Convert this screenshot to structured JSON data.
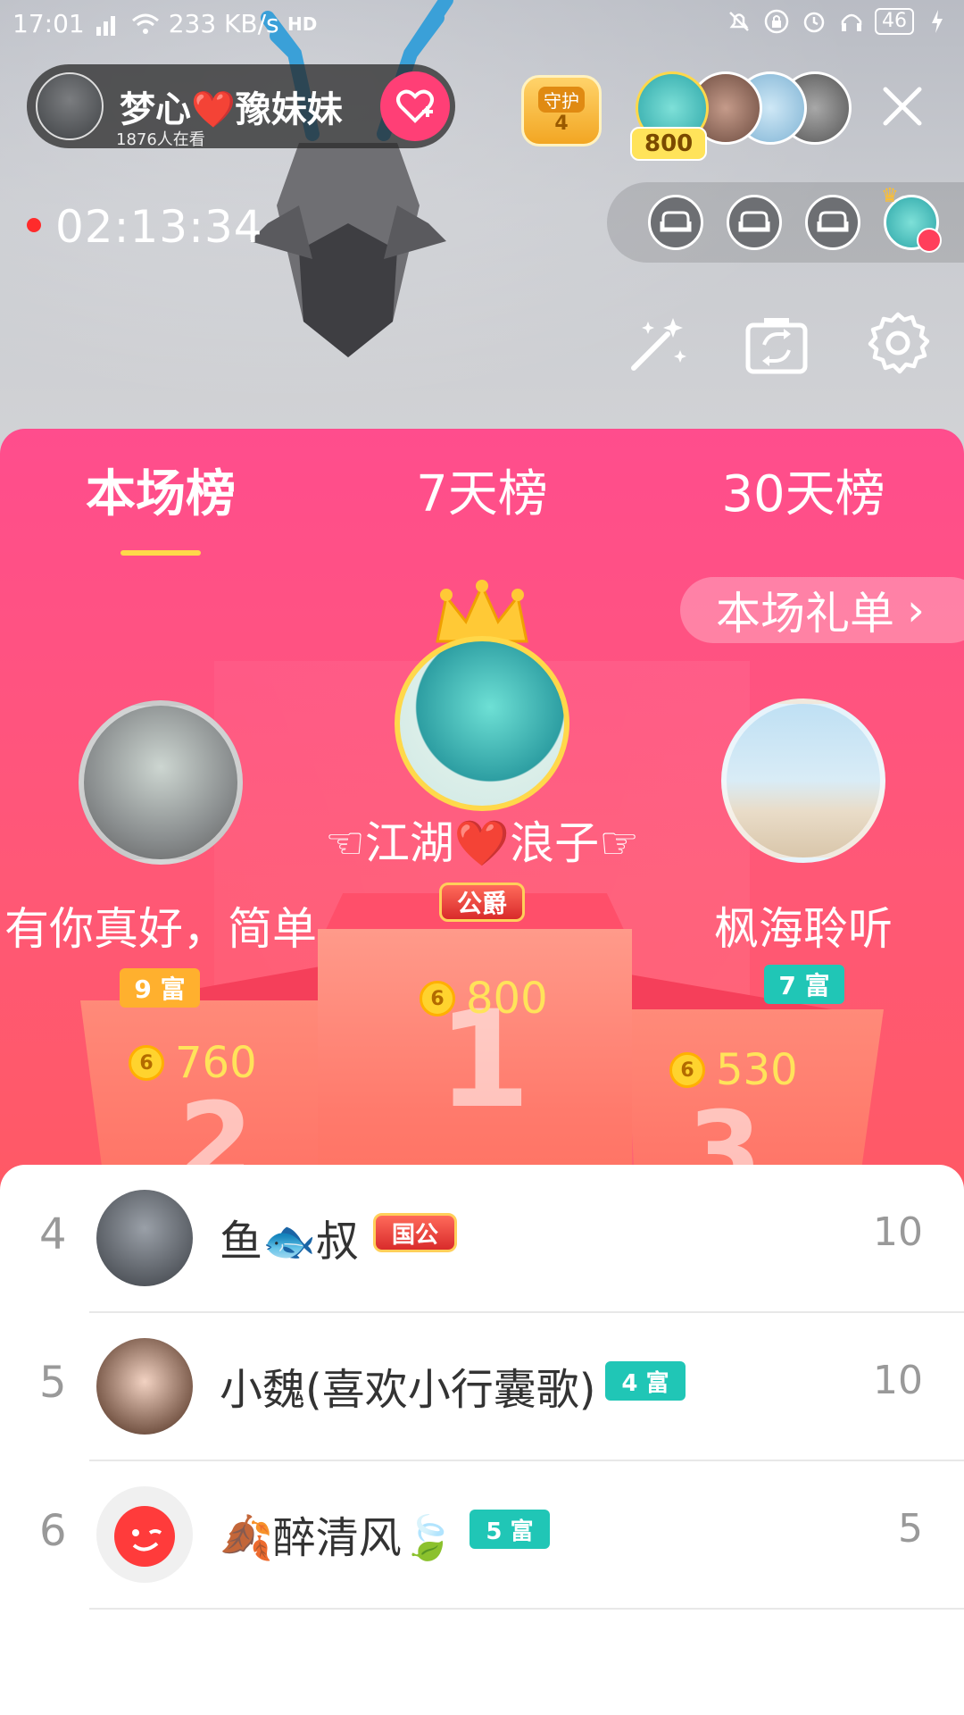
{
  "status_bar": {
    "time": "17:01",
    "network_speed": "233 KB/s",
    "battery": "46"
  },
  "host": {
    "name": "梦心❤️豫妹妹",
    "sub_text": "1876人在看"
  },
  "guard": {
    "label": "守护",
    "count": "4"
  },
  "viewers": {
    "top_count": "800"
  },
  "live": {
    "timer": "02:13:34"
  },
  "tabs": [
    {
      "label": "本场榜"
    },
    {
      "label": "7天榜"
    },
    {
      "label": "30天榜"
    }
  ],
  "gift_list_button": {
    "label": "本场礼单",
    "chevron": "›"
  },
  "podium": {
    "first": {
      "name": "☜江湖❤️浪子☞",
      "badge": "公爵",
      "coins": "800",
      "step": "1"
    },
    "second": {
      "name": "有你真好，简单",
      "badge": "9 富",
      "coins": "760",
      "step": "2"
    },
    "third": {
      "name": "枫海聆听",
      "badge": "7 富",
      "coins": "530",
      "step": "3"
    }
  },
  "list": [
    {
      "rank": "4",
      "name": "鱼🐟叔",
      "tag": "国公",
      "score": "10"
    },
    {
      "rank": "5",
      "name": "小魏(喜欢小行囊歌)",
      "tag": "4 富",
      "score": "10"
    },
    {
      "rank": "6",
      "name": "🍂醉清风🍃",
      "tag": "5 富",
      "score": "5"
    }
  ],
  "colors": {
    "panel_top": "#ff4d8d",
    "panel_bottom": "#ff6b5a",
    "accent_yellow": "#ffd84a",
    "teal": "#20c6b6"
  }
}
